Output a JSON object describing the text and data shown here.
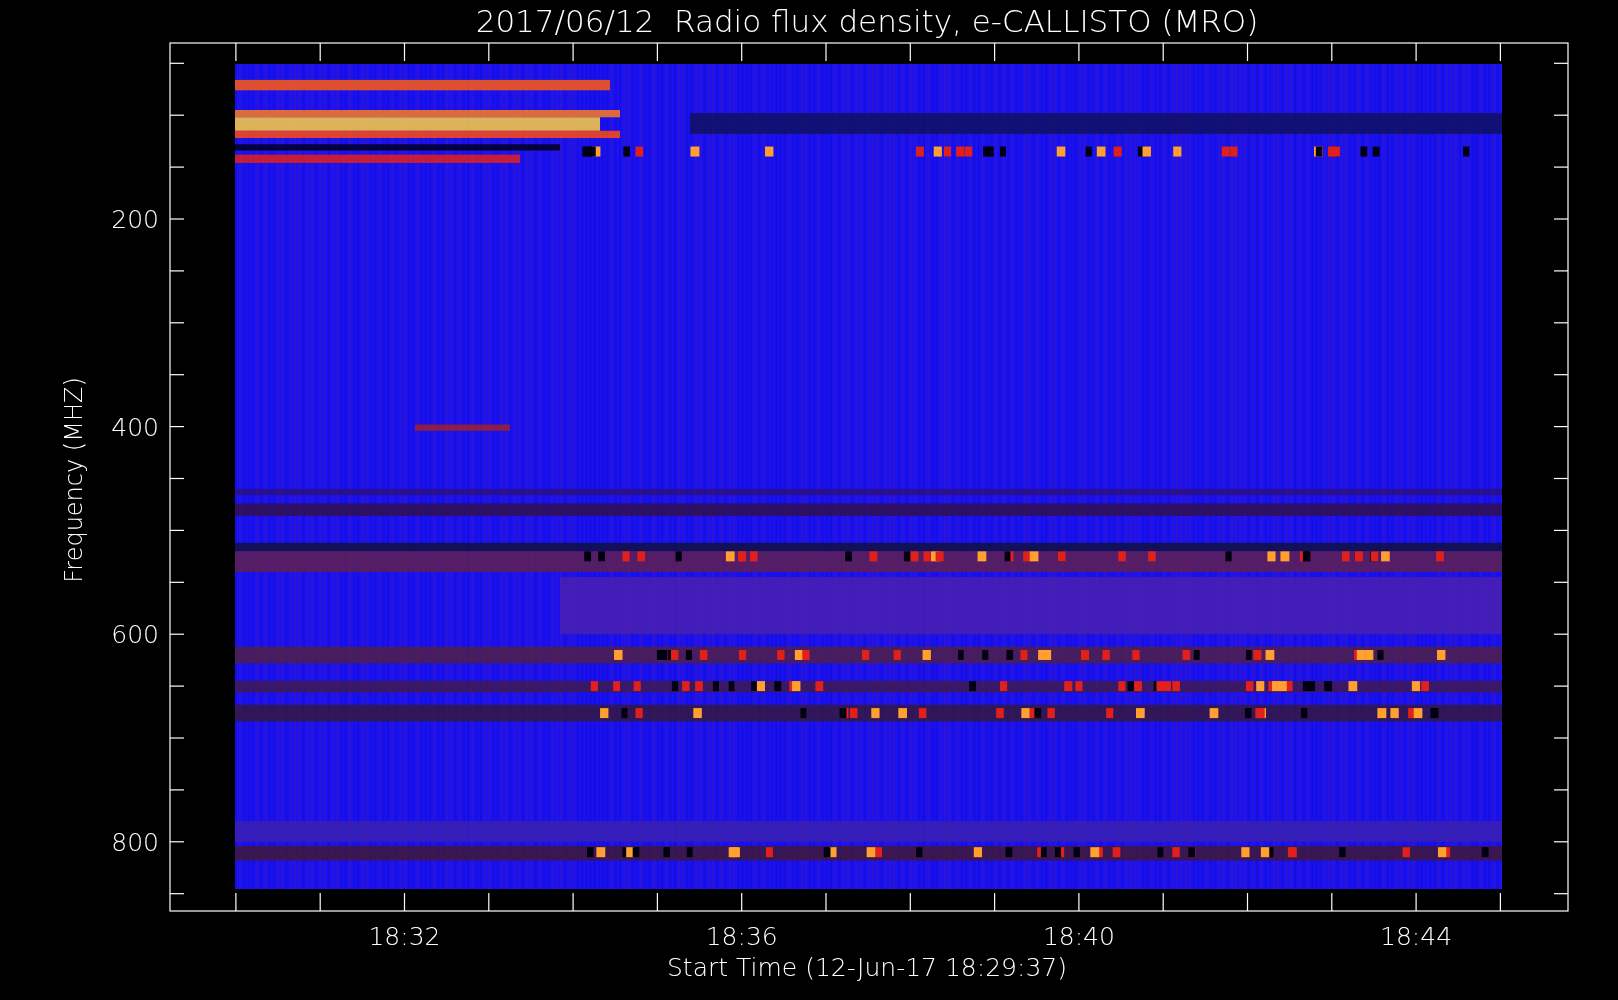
{
  "title": "2017/06/12  Radio flux density, e-CALLISTO (MRO)",
  "y_axis": {
    "label": "Frequency (MHZ)",
    "ticks": [
      "200",
      "400",
      "600",
      "800"
    ]
  },
  "x_axis": {
    "label": "Start Time (12-Jun-17 18:29:37)",
    "ticks": [
      "18:32",
      "18:36",
      "18:40",
      "18:44"
    ]
  }
}
